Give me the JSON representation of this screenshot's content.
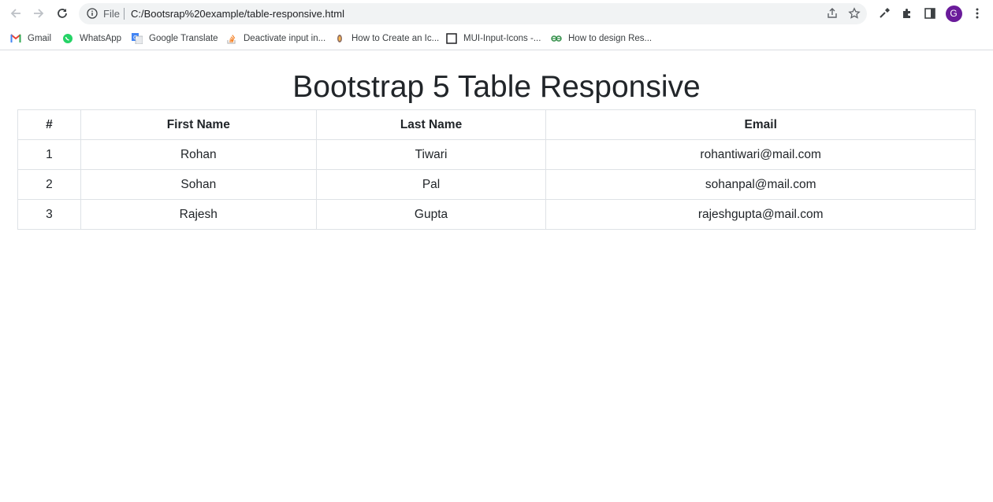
{
  "browser": {
    "file_label": "File",
    "url": "C:/Bootsrap%20example/table-responsive.html",
    "avatar_letter": "G",
    "avatar_color": "#6a1b9a",
    "bookmarks": [
      {
        "label": "Gmail",
        "icon": "gmail-icon"
      },
      {
        "label": "WhatsApp",
        "icon": "whatsapp-icon"
      },
      {
        "label": "Google Translate",
        "icon": "translate-icon"
      },
      {
        "label": "Deactivate input in...",
        "icon": "stackoverflow-icon"
      },
      {
        "label": "How to Create an Ic...",
        "icon": "site-icon"
      },
      {
        "label": "MUI-Input-Icons -...",
        "icon": "page-icon"
      },
      {
        "label": "How to design Res...",
        "icon": "gfg-icon"
      }
    ]
  },
  "page": {
    "title": "Bootstrap 5 Table Responsive",
    "table": {
      "headers": [
        "#",
        "First Name",
        "Last Name",
        "Email"
      ],
      "rows": [
        [
          "1",
          "Rohan",
          "Tiwari",
          "rohantiwari@mail.com"
        ],
        [
          "2",
          "Sohan",
          "Pal",
          "sohanpal@mail.com"
        ],
        [
          "3",
          "Rajesh",
          "Gupta",
          "rajeshgupta@mail.com"
        ]
      ]
    }
  }
}
